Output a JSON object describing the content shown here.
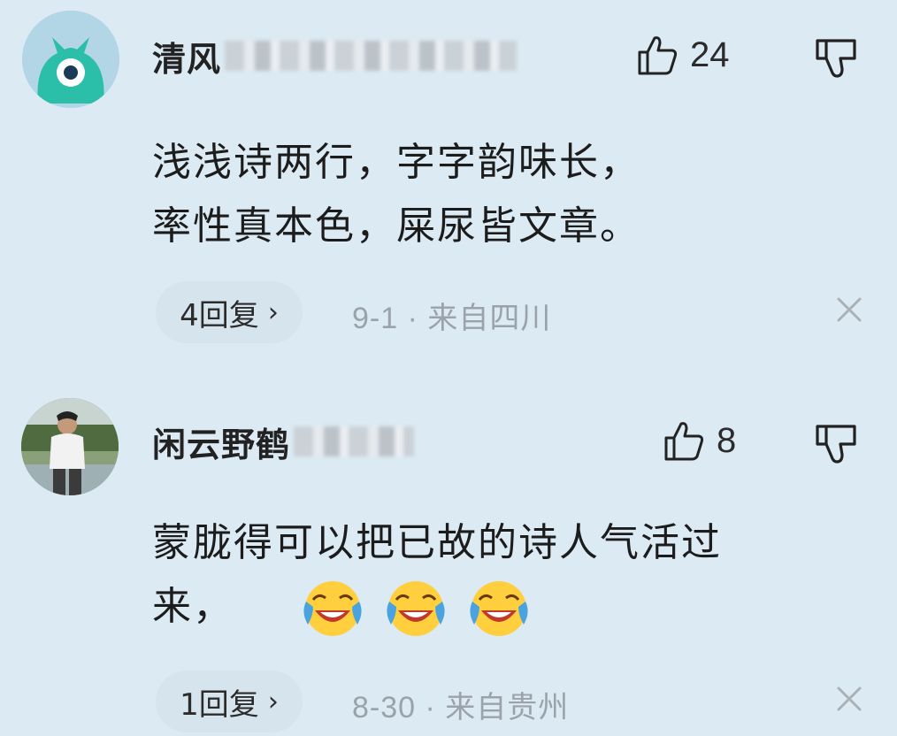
{
  "comments": [
    {
      "username": "清风",
      "like_count": "24",
      "content_lines": [
        "浅浅诗两行，字字韵味长，",
        "率性真本色，屎尿皆文章。"
      ],
      "reply_label": "4回复",
      "chevron": "›",
      "date": "9-1",
      "separator": "·",
      "location": "来自四川"
    },
    {
      "username": "闲云野鹤",
      "like_count": "8",
      "content_lines": [
        "蒙胧得可以把已故的诗人气活过",
        "来，"
      ],
      "emoji_count": 3,
      "reply_label": "1回复",
      "chevron": "›",
      "date": "8-30",
      "separator": "·",
      "location": "来自贵州"
    }
  ],
  "colors": {
    "background": "#dceaf3",
    "pill": "#d6e4ee",
    "meta_text": "#9aa3aa",
    "avatar1_bg": "#a9cfe0",
    "avatar1_fg": "#2bbfa9"
  }
}
